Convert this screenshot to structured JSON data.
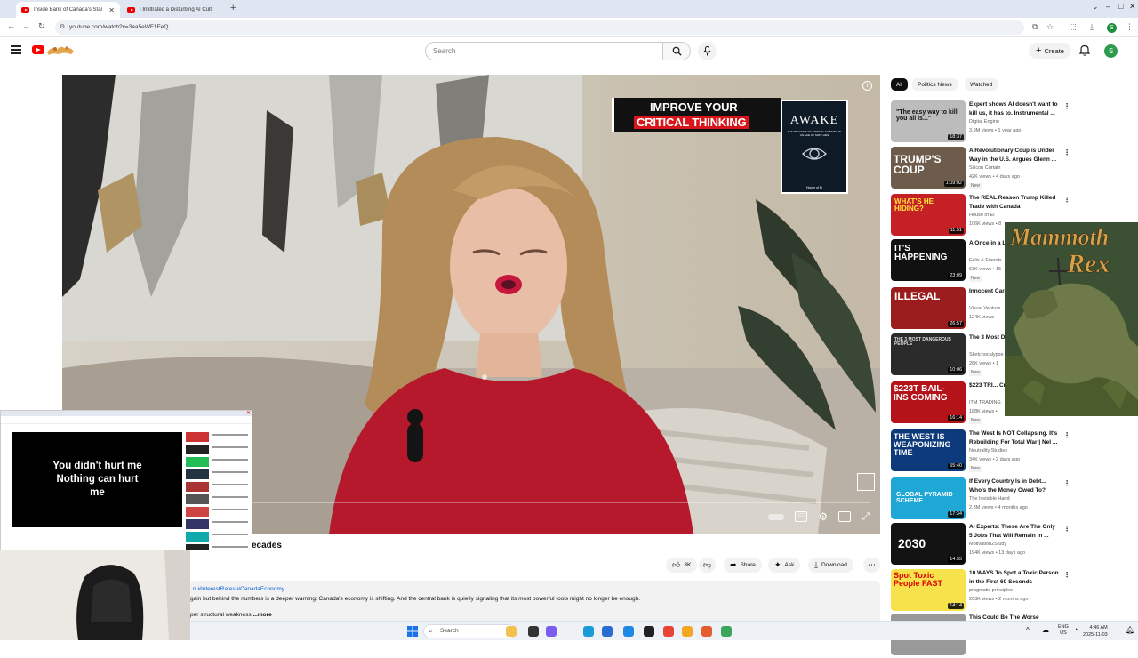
{
  "browser": {
    "tabs": [
      {
        "title": "Inside Bank of Canada's Starkes",
        "active": true
      },
      {
        "title": "I Infiltrated a Disturbing AI Cult",
        "active": false
      }
    ],
    "url": "youtube.com/watch?v=3aa5eWF1EeQ",
    "profile_initial": "S"
  },
  "header": {
    "search_placeholder": "Search",
    "create_label": "Create",
    "avatar_initial": "S"
  },
  "player": {
    "ad_line1": "IMPROVE YOUR",
    "ad_line2": "CRITICAL THINKING",
    "book_title": "AWAKE",
    "book_subtitle": "THE PRACTICE OF CRITICAL THINKING IN AN AGE OF SOFT LIES",
    "book_author": "House of El"
  },
  "overlay_mini": {
    "caption_line1": "You didn't hurt me",
    "caption_line2": "Nothing can hurt",
    "caption_line3": "me"
  },
  "overlay_ad": {
    "title_word1": "Mammoth",
    "title_word2": "Rex"
  },
  "video": {
    "title_fragment": "ecades",
    "likes": "3K",
    "share_label": "Share",
    "ask_label": "Ask",
    "download_label": "Download",
    "tags": "n #InterestRates #CanadaEconomy",
    "desc_line1": "gain but behind the numbers is a deeper warning: Canada's economy is shifting. And the central bank is quietly signaling that its most powerful tools might no longer be enough.",
    "desc_line2": "per structural weakness ",
    "more_label": "...more"
  },
  "sidebar": {
    "chips": [
      "All",
      "Politics News",
      "Watched"
    ],
    "items": [
      {
        "title": "Expert shows AI doesn't want to kill us, it has to. Instrumental ...",
        "channel": "Digital Engine",
        "meta": "3.9M views • 1 year ago",
        "duration": "18:37",
        "badge": "",
        "thumb_text": "\"The easy way to kill you all is...\""
      },
      {
        "title": "A Revolutionary Coup is Under Way in the U.S. Argues Glenn ...",
        "channel": "Silicon Curtain",
        "meta": "42K views • 4 days ago",
        "duration": "1:09:02",
        "badge": "New",
        "thumb_text": "TRUMP'S COUP"
      },
      {
        "title": "The REAL Reason Trump Killed Trade with Canada",
        "channel": "House of El",
        "meta": "106K views • 8",
        "duration": "11:51",
        "badge": "",
        "thumb_text": "WHAT'S HE HIDING?"
      },
      {
        "title": "A Once in a L... Reset That W...",
        "channel": "Felix & Friends",
        "meta": "63K views • 15",
        "duration": "23:09",
        "badge": "New",
        "thumb_text": "IT'S HAPPENING"
      },
      {
        "title": "Innocent Car... Disturbing Or...",
        "channel": "Visual Venture",
        "meta": "124K views",
        "duration": "26:57",
        "badge": "",
        "thumb_text": "ILLEGAL"
      },
      {
        "title": "The 3 Most D... People When...",
        "channel": "Sketchocalypse",
        "meta": "28K views • 1",
        "duration": "10:06",
        "badge": "New",
        "thumb_text": "THE 3 MOST DANGEROUS PEOPLE"
      },
      {
        "title": "$223 TRI... Crisis as U.S...",
        "channel": "ITM TRADING",
        "meta": "188K views •",
        "duration": "16:14",
        "badge": "New",
        "thumb_text": "$223T BAIL-INS COMING"
      },
      {
        "title": "The West Is NOT Collapsing. It's Rebuilding For Total War | Nel ...",
        "channel": "Neutrality Studies",
        "meta": "34K views • 2 days ago",
        "duration": "55:40",
        "badge": "New",
        "thumb_text": "THE WEST IS WEAPONIZING TIME"
      },
      {
        "title": "If Every Country Is in Debt... Who's the Money Owed To?",
        "channel": "The Invisible Hand",
        "meta": "2.3M views • 4 months ago",
        "duration": "17:34",
        "badge": "",
        "thumb_text": "GLOBAL PYRAMID SCHEME"
      },
      {
        "title": "AI Experts: These Are The Only 5 Jobs That Will Remain in ...",
        "channel": "Motivation2Study",
        "meta": "194K views • 13 days ago",
        "duration": "14:55",
        "badge": "",
        "thumb_text": "2030"
      },
      {
        "title": "10 WAYS To Spot a Toxic Person in the First 60 Seconds",
        "channel": "pragmatic principles",
        "meta": "203K views • 2 months ago",
        "duration": "14:14",
        "badge": "",
        "thumb_text": "Spot Toxic People FAST"
      },
      {
        "title": "This Could Be The Worse",
        "channel": "",
        "meta": "",
        "duration": "",
        "badge": "",
        "thumb_text": ""
      }
    ]
  },
  "taskbar": {
    "search_label": "Search",
    "lang_line1": "ENG",
    "lang_line2": "US",
    "time": "4:46 AM",
    "date": "2025-11-03"
  }
}
